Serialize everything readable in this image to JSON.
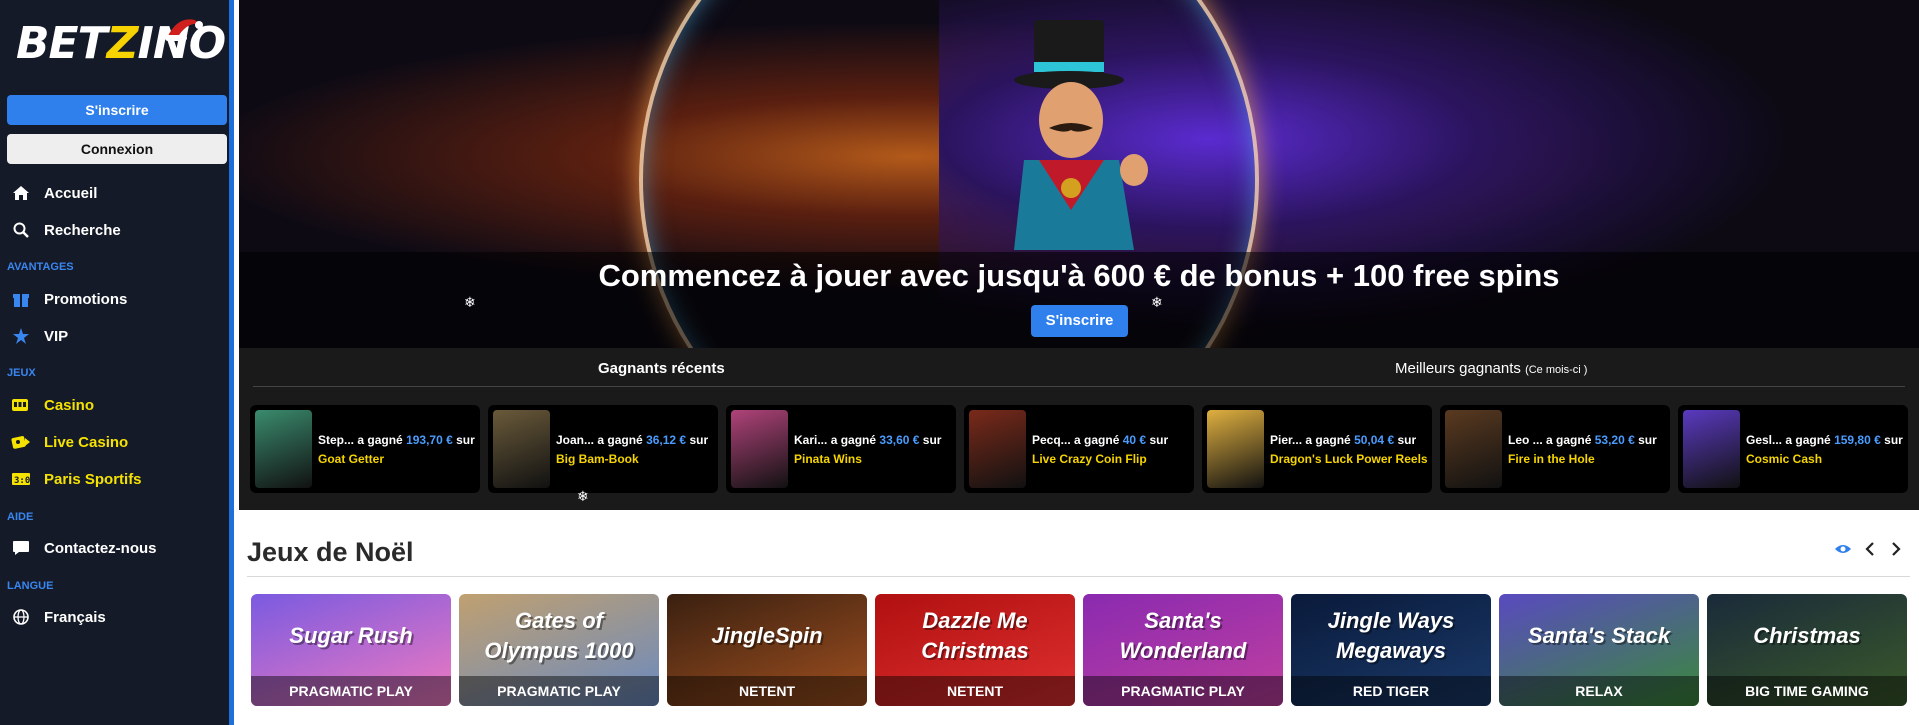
{
  "brand": {
    "logo_text_1": "BET",
    "logo_text_z": "Z",
    "logo_text_2": "INO"
  },
  "sidebar": {
    "signup_label": "S'inscrire",
    "login_label": "Connexion",
    "home": "Accueil",
    "search": "Recherche",
    "section_advantages": "AVANTAGES",
    "promotions": "Promotions",
    "vip": "VIP",
    "section_games": "JEUX",
    "casino": "Casino",
    "live_casino": "Live Casino",
    "sports": "Paris Sportifs",
    "section_help": "AIDE",
    "contact": "Contactez-nous",
    "section_language": "LANGUE",
    "language": "Français"
  },
  "hero": {
    "title": "Commencez à jouer avec jusqu'à 600 € de bonus + 100 free spins",
    "cta_label": "S'inscrire"
  },
  "winners": {
    "tab_recent": "Gagnants récents",
    "tab_best": "Meilleurs gagnants",
    "tab_best_note": "(Ce mois-ci )",
    "won_word": "a gagné",
    "on_word": "sur",
    "items": [
      {
        "name": "Step...",
        "amount": "193,70 €",
        "game": "Goat Getter",
        "thumb": "#3a8b6e"
      },
      {
        "name": "Joan...",
        "amount": "36,12 €",
        "game": "Big Bam-Book",
        "thumb": "#6a5a3a"
      },
      {
        "name": "Kari...",
        "amount": "33,60 €",
        "game": "Pinata Wins",
        "thumb": "#b0437a"
      },
      {
        "name": "Pecq...",
        "amount": "40 €",
        "game": "Live Crazy Coin Flip",
        "thumb": "#7a2a1a"
      },
      {
        "name": "Pier...",
        "amount": "50,04 €",
        "game": "Dragon's Luck Power Reels",
        "thumb": "#e0b040"
      },
      {
        "name": "Leo ...",
        "amount": "53,20 €",
        "game": "Fire in the Hole",
        "thumb": "#5a3a20"
      },
      {
        "name": "Gesl...",
        "amount": "159,80 €",
        "game": "Cosmic Cash",
        "thumb": "#5a3ac0"
      }
    ]
  },
  "christmas": {
    "title": "Jeux de Noël",
    "games": [
      {
        "art": "Sugar Rush",
        "provider": "PRAGMATIC PLAY",
        "color1": "#7a5ae0",
        "color2": "#f07ac0"
      },
      {
        "art": "Gates of Olympus 1000",
        "provider": "PRAGMATIC PLAY",
        "color1": "#c0a070",
        "color2": "#6a8ac0"
      },
      {
        "art": "JingleSpin",
        "provider": "NETENT",
        "color1": "#3a2010",
        "color2": "#a05020"
      },
      {
        "art": "Dazzle Me Christmas",
        "provider": "NETENT",
        "color1": "#b01010",
        "color2": "#e03030"
      },
      {
        "art": "Santa's Wonderland",
        "provider": "PRAGMATIC PLAY",
        "color1": "#8a2ab0",
        "color2": "#c040a0"
      },
      {
        "art": "Jingle Ways Megaways",
        "provider": "RED TIGER",
        "color1": "#0a1a3a",
        "color2": "#1a3a6a"
      },
      {
        "art": "Santa's Stack",
        "provider": "RELAX",
        "color1": "#5a4ac0",
        "color2": "#3a8a3a"
      },
      {
        "art": "Christmas",
        "provider": "BIG TIME GAMING",
        "color1": "#1a2a3a",
        "color2": "#3a5a2a"
      }
    ]
  },
  "colors": {
    "accent": "#2f80ed",
    "yellow": "#f5e200",
    "sidebar_bg": "#141a27"
  }
}
